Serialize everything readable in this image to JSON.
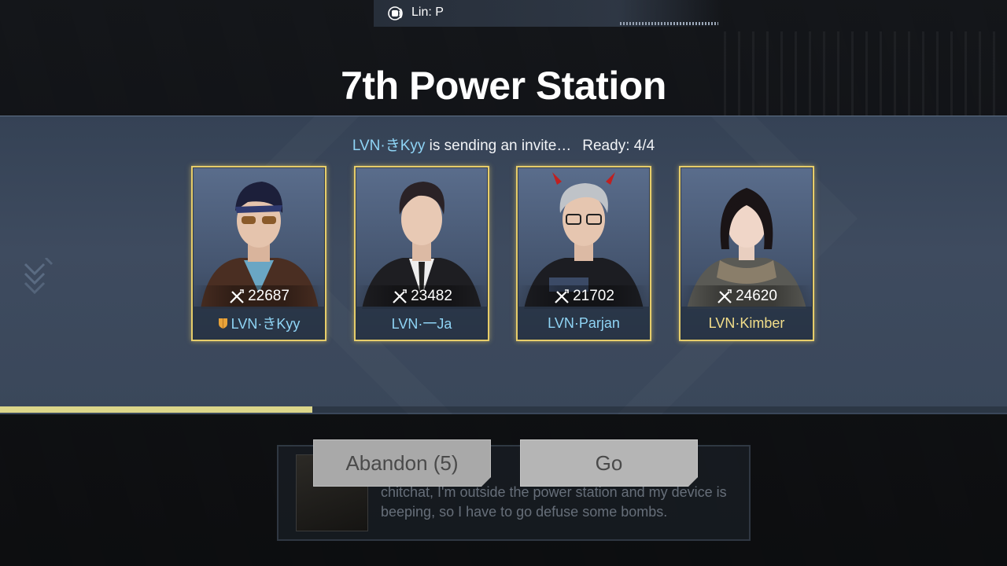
{
  "voice": {
    "speaker": "Lin: P"
  },
  "title": "7th Power Station",
  "status": {
    "inviter": "LVN·きKyy",
    "invite_text": " is sending an invite…",
    "ready": "Ready: 4/4"
  },
  "players": [
    {
      "power": "22687",
      "name": "LVN·きKyy",
      "leader": true,
      "name_color": "#8fd4f5"
    },
    {
      "power": "23482",
      "name": "LVN·一Ja",
      "leader": false,
      "name_color": "#8fd4f5"
    },
    {
      "power": "21702",
      "name": "LVN·Parjan",
      "leader": false,
      "name_color": "#8fd4f5"
    },
    {
      "power": "24620",
      "name": "LVN·Kimber",
      "leader": false,
      "name_color": "#f3de8a"
    }
  ],
  "countdown_progress": 0.31,
  "buttons": {
    "abandon": "Abandon (5)",
    "go": "Go"
  },
  "background_dialog": {
    "text": "chitchat, I'm outside the power station and my device is beeping, so I have to go defuse some bombs."
  },
  "colors": {
    "frame_gold": "#e6cd6a",
    "name_blue": "#8fd4f5",
    "progress": "#dcd68a"
  }
}
